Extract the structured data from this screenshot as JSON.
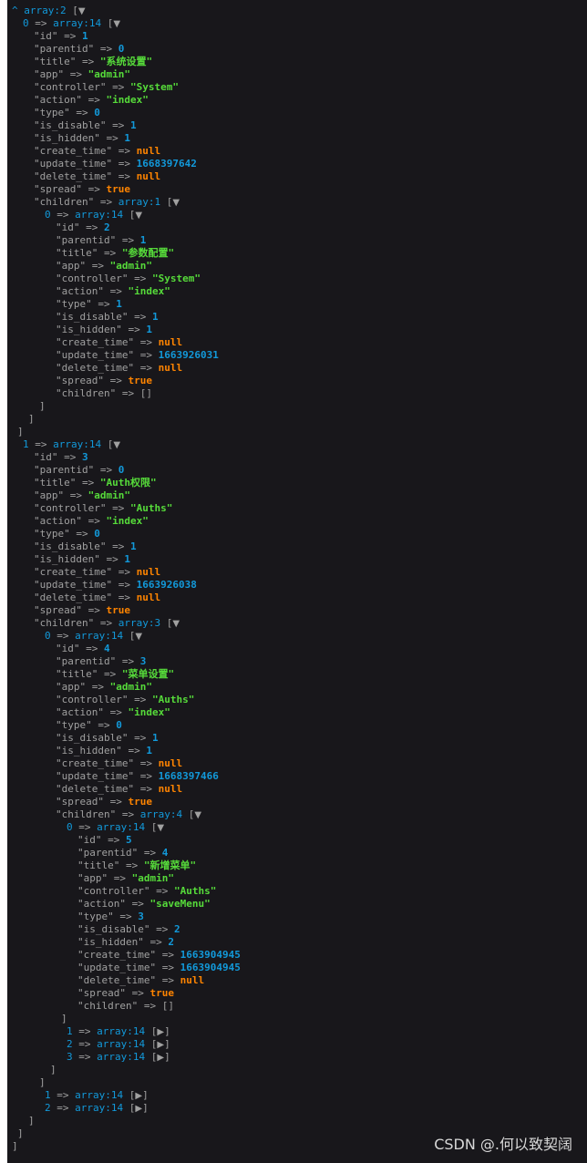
{
  "dump": {
    "lines": [
      {
        "d": 0,
        "t": "root",
        "note": "array:2",
        "tog": "▼"
      },
      {
        "d": 1,
        "t": "arr",
        "key": "0",
        "note": "array:14",
        "tog": "▼"
      },
      {
        "d": 2,
        "t": "kv",
        "key": "id",
        "val": "1",
        "vt": "num"
      },
      {
        "d": 2,
        "t": "kv",
        "key": "parentid",
        "val": "0",
        "vt": "num"
      },
      {
        "d": 2,
        "t": "kv",
        "key": "title",
        "val": "系统设置",
        "vt": "str"
      },
      {
        "d": 2,
        "t": "kv",
        "key": "app",
        "val": "admin",
        "vt": "str"
      },
      {
        "d": 2,
        "t": "kv",
        "key": "controller",
        "val": "System",
        "vt": "str"
      },
      {
        "d": 2,
        "t": "kv",
        "key": "action",
        "val": "index",
        "vt": "str"
      },
      {
        "d": 2,
        "t": "kv",
        "key": "type",
        "val": "0",
        "vt": "num"
      },
      {
        "d": 2,
        "t": "kv",
        "key": "is_disable",
        "val": "1",
        "vt": "num"
      },
      {
        "d": 2,
        "t": "kv",
        "key": "is_hidden",
        "val": "1",
        "vt": "num"
      },
      {
        "d": 2,
        "t": "kv",
        "key": "create_time",
        "val": "null",
        "vt": "const"
      },
      {
        "d": 2,
        "t": "kv",
        "key": "update_time",
        "val": "1668397642",
        "vt": "num"
      },
      {
        "d": 2,
        "t": "kv",
        "key": "delete_time",
        "val": "null",
        "vt": "const"
      },
      {
        "d": 2,
        "t": "kv",
        "key": "spread",
        "val": "true",
        "vt": "const"
      },
      {
        "d": 2,
        "t": "karr",
        "key": "children",
        "note": "array:1",
        "tog": "▼"
      },
      {
        "d": 3,
        "t": "arr",
        "key": "0",
        "note": "array:14",
        "tog": "▼"
      },
      {
        "d": 4,
        "t": "kv",
        "key": "id",
        "val": "2",
        "vt": "num"
      },
      {
        "d": 4,
        "t": "kv",
        "key": "parentid",
        "val": "1",
        "vt": "num"
      },
      {
        "d": 4,
        "t": "kv",
        "key": "title",
        "val": "参数配置",
        "vt": "str"
      },
      {
        "d": 4,
        "t": "kv",
        "key": "app",
        "val": "admin",
        "vt": "str"
      },
      {
        "d": 4,
        "t": "kv",
        "key": "controller",
        "val": "System",
        "vt": "str"
      },
      {
        "d": 4,
        "t": "kv",
        "key": "action",
        "val": "index",
        "vt": "str"
      },
      {
        "d": 4,
        "t": "kv",
        "key": "type",
        "val": "1",
        "vt": "num"
      },
      {
        "d": 4,
        "t": "kv",
        "key": "is_disable",
        "val": "1",
        "vt": "num"
      },
      {
        "d": 4,
        "t": "kv",
        "key": "is_hidden",
        "val": "1",
        "vt": "num"
      },
      {
        "d": 4,
        "t": "kv",
        "key": "create_time",
        "val": "null",
        "vt": "const"
      },
      {
        "d": 4,
        "t": "kv",
        "key": "update_time",
        "val": "1663926031",
        "vt": "num"
      },
      {
        "d": 4,
        "t": "kv",
        "key": "delete_time",
        "val": "null",
        "vt": "const"
      },
      {
        "d": 4,
        "t": "kv",
        "key": "spread",
        "val": "true",
        "vt": "const"
      },
      {
        "d": 4,
        "t": "kempty",
        "key": "children",
        "val": "[]"
      },
      {
        "d": 3,
        "t": "close",
        "val": "]"
      },
      {
        "d": 2,
        "t": "close",
        "val": "]"
      },
      {
        "d": 1,
        "t": "close",
        "val": "]"
      },
      {
        "d": 1,
        "t": "arr",
        "key": "1",
        "note": "array:14",
        "tog": "▼"
      },
      {
        "d": 2,
        "t": "kv",
        "key": "id",
        "val": "3",
        "vt": "num"
      },
      {
        "d": 2,
        "t": "kv",
        "key": "parentid",
        "val": "0",
        "vt": "num"
      },
      {
        "d": 2,
        "t": "kv",
        "key": "title",
        "val": "Auth权限",
        "vt": "str"
      },
      {
        "d": 2,
        "t": "kv",
        "key": "app",
        "val": "admin",
        "vt": "str"
      },
      {
        "d": 2,
        "t": "kv",
        "key": "controller",
        "val": "Auths",
        "vt": "str"
      },
      {
        "d": 2,
        "t": "kv",
        "key": "action",
        "val": "index",
        "vt": "str"
      },
      {
        "d": 2,
        "t": "kv",
        "key": "type",
        "val": "0",
        "vt": "num"
      },
      {
        "d": 2,
        "t": "kv",
        "key": "is_disable",
        "val": "1",
        "vt": "num"
      },
      {
        "d": 2,
        "t": "kv",
        "key": "is_hidden",
        "val": "1",
        "vt": "num"
      },
      {
        "d": 2,
        "t": "kv",
        "key": "create_time",
        "val": "null",
        "vt": "const"
      },
      {
        "d": 2,
        "t": "kv",
        "key": "update_time",
        "val": "1663926038",
        "vt": "num"
      },
      {
        "d": 2,
        "t": "kv",
        "key": "delete_time",
        "val": "null",
        "vt": "const"
      },
      {
        "d": 2,
        "t": "kv",
        "key": "spread",
        "val": "true",
        "vt": "const"
      },
      {
        "d": 2,
        "t": "karr",
        "key": "children",
        "note": "array:3",
        "tog": "▼"
      },
      {
        "d": 3,
        "t": "arr",
        "key": "0",
        "note": "array:14",
        "tog": "▼"
      },
      {
        "d": 4,
        "t": "kv",
        "key": "id",
        "val": "4",
        "vt": "num"
      },
      {
        "d": 4,
        "t": "kv",
        "key": "parentid",
        "val": "3",
        "vt": "num"
      },
      {
        "d": 4,
        "t": "kv",
        "key": "title",
        "val": "菜单设置",
        "vt": "str"
      },
      {
        "d": 4,
        "t": "kv",
        "key": "app",
        "val": "admin",
        "vt": "str"
      },
      {
        "d": 4,
        "t": "kv",
        "key": "controller",
        "val": "Auths",
        "vt": "str"
      },
      {
        "d": 4,
        "t": "kv",
        "key": "action",
        "val": "index",
        "vt": "str"
      },
      {
        "d": 4,
        "t": "kv",
        "key": "type",
        "val": "0",
        "vt": "num"
      },
      {
        "d": 4,
        "t": "kv",
        "key": "is_disable",
        "val": "1",
        "vt": "num"
      },
      {
        "d": 4,
        "t": "kv",
        "key": "is_hidden",
        "val": "1",
        "vt": "num"
      },
      {
        "d": 4,
        "t": "kv",
        "key": "create_time",
        "val": "null",
        "vt": "const"
      },
      {
        "d": 4,
        "t": "kv",
        "key": "update_time",
        "val": "1668397466",
        "vt": "num"
      },
      {
        "d": 4,
        "t": "kv",
        "key": "delete_time",
        "val": "null",
        "vt": "const"
      },
      {
        "d": 4,
        "t": "kv",
        "key": "spread",
        "val": "true",
        "vt": "const"
      },
      {
        "d": 4,
        "t": "karr",
        "key": "children",
        "note": "array:4",
        "tog": "▼"
      },
      {
        "d": 5,
        "t": "arr",
        "key": "0",
        "note": "array:14",
        "tog": "▼"
      },
      {
        "d": 6,
        "t": "kv",
        "key": "id",
        "val": "5",
        "vt": "num"
      },
      {
        "d": 6,
        "t": "kv",
        "key": "parentid",
        "val": "4",
        "vt": "num"
      },
      {
        "d": 6,
        "t": "kv",
        "key": "title",
        "val": "新增菜单",
        "vt": "str"
      },
      {
        "d": 6,
        "t": "kv",
        "key": "app",
        "val": "admin",
        "vt": "str"
      },
      {
        "d": 6,
        "t": "kv",
        "key": "controller",
        "val": "Auths",
        "vt": "str"
      },
      {
        "d": 6,
        "t": "kv",
        "key": "action",
        "val": "saveMenu",
        "vt": "str"
      },
      {
        "d": 6,
        "t": "kv",
        "key": "type",
        "val": "3",
        "vt": "num"
      },
      {
        "d": 6,
        "t": "kv",
        "key": "is_disable",
        "val": "2",
        "vt": "num"
      },
      {
        "d": 6,
        "t": "kv",
        "key": "is_hidden",
        "val": "2",
        "vt": "num"
      },
      {
        "d": 6,
        "t": "kv",
        "key": "create_time",
        "val": "1663904945",
        "vt": "num"
      },
      {
        "d": 6,
        "t": "kv",
        "key": "update_time",
        "val": "1663904945",
        "vt": "num"
      },
      {
        "d": 6,
        "t": "kv",
        "key": "delete_time",
        "val": "null",
        "vt": "const"
      },
      {
        "d": 6,
        "t": "kv",
        "key": "spread",
        "val": "true",
        "vt": "const"
      },
      {
        "d": 6,
        "t": "kempty",
        "key": "children",
        "val": "[]"
      },
      {
        "d": 5,
        "t": "close",
        "val": "]"
      },
      {
        "d": 5,
        "t": "arrc",
        "key": "1",
        "note": "array:14",
        "tog": "▶"
      },
      {
        "d": 5,
        "t": "arrc",
        "key": "2",
        "note": "array:14",
        "tog": "▶"
      },
      {
        "d": 5,
        "t": "arrc",
        "key": "3",
        "note": "array:14",
        "tog": "▶"
      },
      {
        "d": 4,
        "t": "close",
        "val": "]"
      },
      {
        "d": 3,
        "t": "close",
        "val": "]"
      },
      {
        "d": 3,
        "t": "arrc",
        "key": "1",
        "note": "array:14",
        "tog": "▶"
      },
      {
        "d": 3,
        "t": "arrc",
        "key": "2",
        "note": "array:14",
        "tog": "▶"
      },
      {
        "d": 2,
        "t": "close",
        "val": "]"
      },
      {
        "d": 1,
        "t": "close",
        "val": "]"
      },
      {
        "d": 0,
        "t": "close",
        "val": "]"
      }
    ]
  },
  "watermark": "CSDN @.​何以致契阔",
  "colors": {
    "background": "#18171b",
    "key": "#a0a0a0",
    "number": "#1299da",
    "string": "#56db3a",
    "constant": "#ff8400"
  }
}
